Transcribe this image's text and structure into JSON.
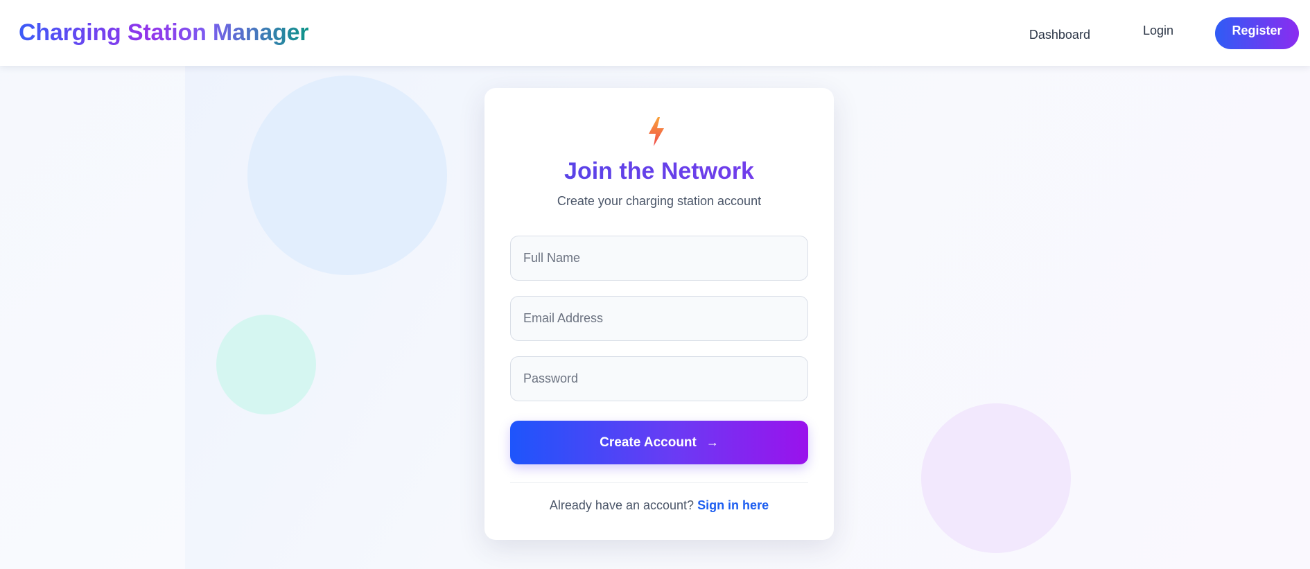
{
  "header": {
    "brand": "Charging Station Manager",
    "nav": {
      "dashboard": "Dashboard",
      "login": "Login",
      "register": "Register"
    }
  },
  "card": {
    "icon": "lightning-bolt-icon",
    "title": "Join the Network",
    "subtitle": "Create your charging station account",
    "fields": {
      "full_name_placeholder": "Full Name",
      "email_placeholder": "Email Address",
      "password_placeholder": "Password"
    },
    "submit_label": "Create Account",
    "submit_icon": "arrow-right-icon",
    "footer_text": "Already have an account?",
    "footer_link": "Sign in here"
  },
  "colors": {
    "accent_blue": "#2f5cf5",
    "accent_purple": "#8b2cf0",
    "link_blue": "#1d5ef0",
    "teal": "#0d9488"
  }
}
